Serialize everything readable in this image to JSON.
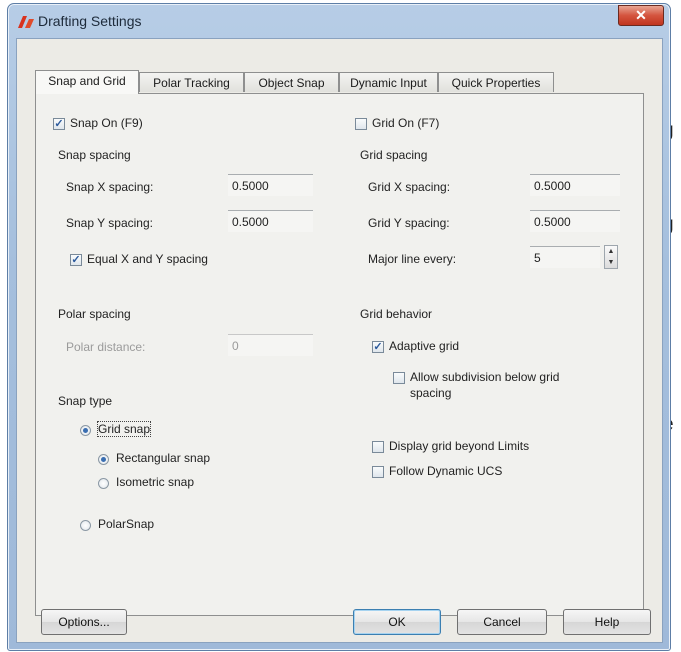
{
  "background_fragments": [
    "g",
    "g",
    "e"
  ],
  "window": {
    "title": "Drafting Settings",
    "close_glyph": "✕"
  },
  "tabs": [
    {
      "label": "Snap and Grid",
      "active": true
    },
    {
      "label": "Polar Tracking",
      "active": false
    },
    {
      "label": "Object Snap",
      "active": false
    },
    {
      "label": "Dynamic Input",
      "active": false
    },
    {
      "label": "Quick Properties",
      "active": false
    }
  ],
  "snap": {
    "snap_on_label": "Snap On (F9)",
    "snap_on_checked": true,
    "snap_spacing_heading": "Snap spacing",
    "x_label": "Snap X spacing:",
    "x_value": "0.5000",
    "y_label": "Snap Y spacing:",
    "y_value": "0.5000",
    "equal_label": "Equal X and Y spacing",
    "equal_checked": true,
    "polar_heading": "Polar spacing",
    "polar_label": "Polar distance:",
    "polar_value": "0",
    "type_heading": "Snap type",
    "grid_snap_label": "Grid snap",
    "rect_label": "Rectangular snap",
    "iso_label": "Isometric snap",
    "polarsnap_label": "PolarSnap"
  },
  "grid": {
    "grid_on_label": "Grid On (F7)",
    "grid_on_checked": false,
    "spacing_heading": "Grid spacing",
    "x_label": "Grid X spacing:",
    "x_value": "0.5000",
    "y_label": "Grid Y spacing:",
    "y_value": "0.5000",
    "major_label": "Major line every:",
    "major_value": "5",
    "behavior_heading": "Grid behavior",
    "adaptive_label": "Adaptive grid",
    "adaptive_checked": true,
    "subdivision_label_1": "Allow subdivision below grid",
    "subdivision_label_2": "spacing",
    "subdivision_checked": false,
    "beyond_limits_label": "Display grid beyond Limits",
    "beyond_limits_checked": false,
    "dynamic_ucs_label": "Follow Dynamic UCS",
    "dynamic_ucs_checked": false
  },
  "buttons": {
    "options": "Options...",
    "ok": "OK",
    "cancel": "Cancel",
    "help": "Help"
  },
  "colors": {
    "title_gradient": "#a5bfdd",
    "close_button": "#c0351f",
    "dialog_face": "#ecebe6",
    "check_mark": "#2c5a9c"
  }
}
